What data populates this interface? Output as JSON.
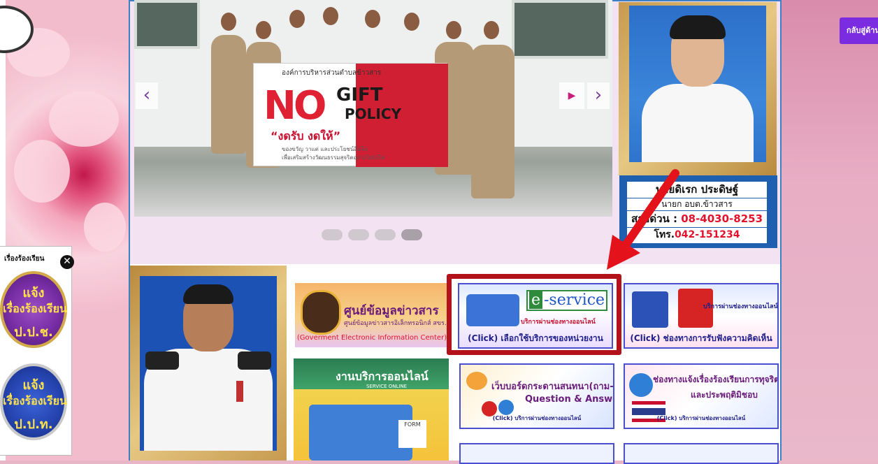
{
  "colors": {
    "accent_purple": "#7c2ce0",
    "highlight_red": "#b3121a",
    "panel_border": "#3d7fc4",
    "tile_border": "#4a4ed0"
  },
  "slider": {
    "banner": {
      "org": "องค์การบริหารส่วนตำบลข้าวสาร",
      "no": "NO",
      "gift": "GIFT",
      "policy": "POLICY",
      "slogan": "“งดรับ งดให้”",
      "sub1": "ของขวัญ วาแต่ และประโยชน์อื่นใด",
      "sub2": "เพื่อเสริมสร้างวัฒนธรรมสุจริตอย่างโปร่งใส"
    },
    "prev_icon": "‹",
    "next_icon": "›",
    "play_icon": "▶",
    "dots": 4,
    "active_dot": 4
  },
  "mayor": {
    "name": "นายดิเรก ประดิษฐ์",
    "title": "นายก อบต.ข้าวสาร",
    "hotline_label": "สายด่วน : ",
    "hotline_number": "08-4030-8253",
    "tel_label": "โทร.",
    "tel_number": "042-151234"
  },
  "tiles": {
    "info_center": {
      "title": "ศูนย์ข้อมูลข่าวสาร",
      "subtitle": "ศูนย์ข้อมูลข่าวสารอิเล็กทรอนิกส์ สขร.",
      "footer": "(Goverment Electronic Information Center)"
    },
    "eservice": {
      "label_e": "e",
      "label_rest": "-service",
      "subtitle": "บริการผ่านช่องทางออนไลน์",
      "footer": "(Click) เลือกใช้บริการของหน่วยงาน"
    },
    "feedback": {
      "subtitle": "บริการผ่านช่องทางออนไลน์",
      "footer": "(Click) ช่องทางการรับฟังความคิดเห็น"
    },
    "online_service": {
      "title": "งานบริการออนไลน์",
      "subtitle": "SERVICE ONLINE",
      "form_label": "FORM"
    },
    "qa": {
      "title": "เว็บบอร์ดกระดานสนทนา(ถาม-ตอบ)",
      "title2": "Question & Answer",
      "footer": "(Click) บริการผ่านช่องทางออนไลน์"
    },
    "corruption": {
      "title": "ช่องทางแจ้งเรื่องร้องเรียนการทุจริต",
      "title2": "และประพฤติมิชอบ",
      "footer": "(Click) บริการผ่านช่องทางออนไลน์"
    }
  },
  "complaint": {
    "title": "เรื่องร้องเรียน",
    "close_icon": "✕",
    "pacc": {
      "line1": "แจ้ง",
      "line2": "เรื่องร้องเรียน",
      "line3": "ป.ป.ช."
    },
    "pactt": {
      "line1": "แจ้ง",
      "line2": "เรื่องร้องเรียน",
      "line3": "ป.ป.ท."
    }
  },
  "back_to_top": "กลับสู่ด้านบน"
}
